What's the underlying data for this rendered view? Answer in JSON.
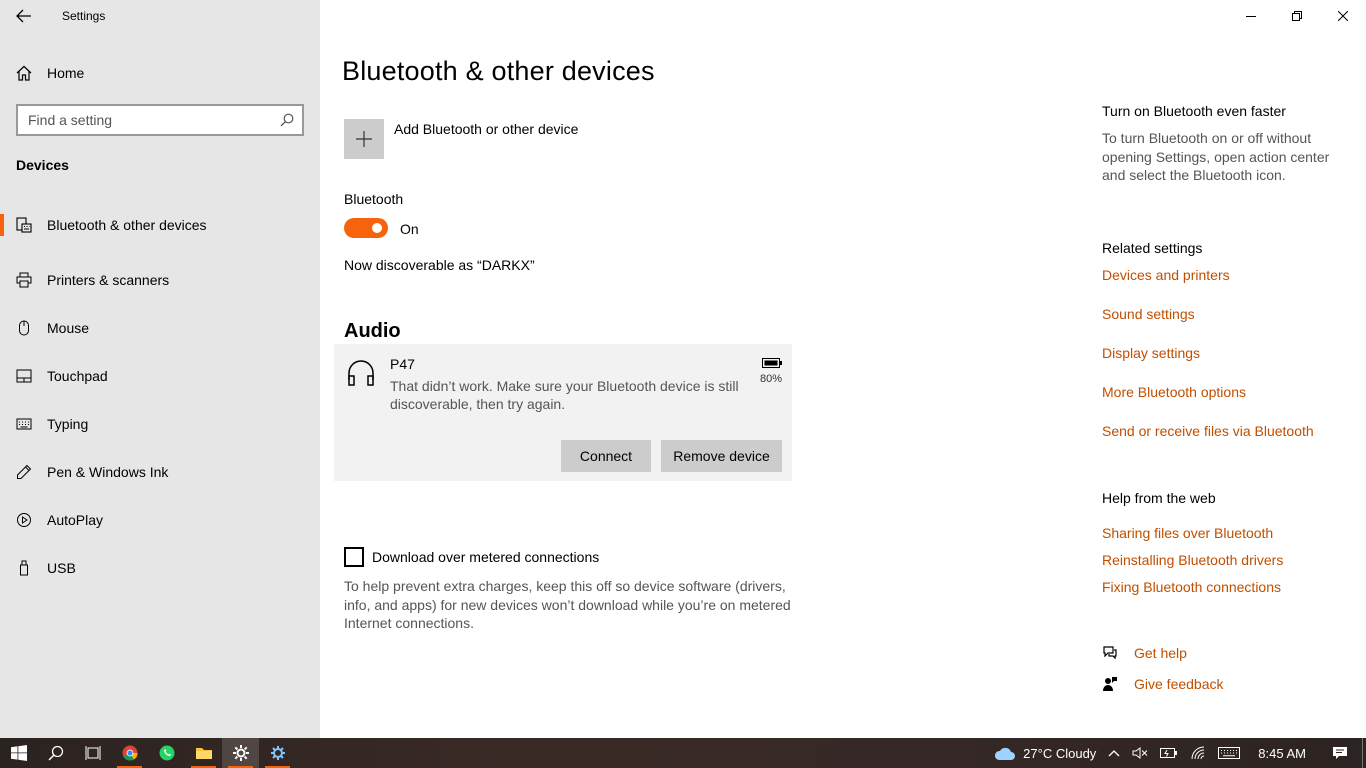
{
  "window": {
    "title": "Settings"
  },
  "sidebar": {
    "home_label": "Home",
    "search_placeholder": "Find a setting",
    "section_header": "Devices",
    "items": [
      {
        "label": "Bluetooth & other devices",
        "icon": "bluetooth-keyboard-icon",
        "active": true
      },
      {
        "label": "Printers & scanners",
        "icon": "printer-icon"
      },
      {
        "label": "Mouse",
        "icon": "mouse-icon"
      },
      {
        "label": "Touchpad",
        "icon": "touchpad-icon"
      },
      {
        "label": "Typing",
        "icon": "keyboard-icon"
      },
      {
        "label": "Pen & Windows Ink",
        "icon": "pen-icon"
      },
      {
        "label": "AutoPlay",
        "icon": "autoplay-icon"
      },
      {
        "label": "USB",
        "icon": "usb-icon"
      }
    ]
  },
  "main": {
    "title": "Bluetooth & other devices",
    "add_device_label": "Add Bluetooth or other device",
    "bluetooth_label": "Bluetooth",
    "toggle_state": "On",
    "discoverable_text": "Now discoverable as “DARKX”",
    "audio_header": "Audio",
    "device": {
      "name": "P47",
      "message": "That didn’t work. Make sure your Bluetooth device is still discoverable, then try again.",
      "battery": "80%",
      "connect_label": "Connect",
      "remove_label": "Remove device"
    },
    "metered_label": "Download over metered connections",
    "metered_desc": "To help prevent extra charges, keep this off so device software (drivers, info, and apps) for new devices won’t download while you’re on metered Internet connections."
  },
  "aside": {
    "faster_title": "Turn on Bluetooth even faster",
    "faster_desc": "To turn Bluetooth on or off without opening Settings, open action center and select the Bluetooth icon.",
    "related_title": "Related settings",
    "related_links": [
      "Devices and printers",
      "Sound settings",
      "Display settings",
      "More Bluetooth options",
      "Send or receive files via Bluetooth"
    ],
    "help_title": "Help from the web",
    "help_links": [
      "Sharing files over Bluetooth",
      "Reinstalling Bluetooth drivers",
      "Fixing Bluetooth connections"
    ],
    "get_help": "Get help",
    "give_feedback": "Give feedback"
  },
  "taskbar": {
    "weather": "27°C  Cloudy",
    "time": "8:45 AM"
  },
  "colors": {
    "accent": "#f7630c",
    "link": "#c04f00",
    "sidebar_bg": "#e6e6e6"
  }
}
